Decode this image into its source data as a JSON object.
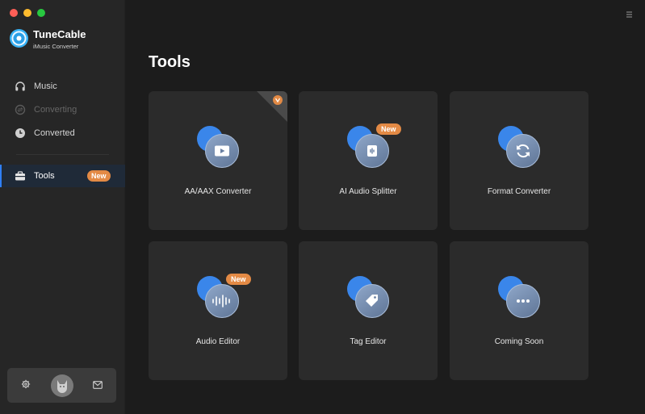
{
  "app": {
    "name": "TuneCable",
    "subtitle": "iMusic Converter"
  },
  "sidebar": {
    "items": [
      {
        "label": "Music",
        "icon": "headphones-icon",
        "state": "normal"
      },
      {
        "label": "Converting",
        "icon": "converting-icon",
        "state": "disabled"
      },
      {
        "label": "Converted",
        "icon": "clock-icon",
        "state": "normal"
      }
    ],
    "tools": {
      "label": "Tools",
      "icon": "toolbox-icon",
      "badge": "New",
      "state": "active"
    }
  },
  "page": {
    "title": "Tools"
  },
  "tools": [
    {
      "label": "AA/AAX Converter",
      "icon": "video-play-icon",
      "badge": "",
      "corner_badge": true
    },
    {
      "label": "AI Audio Splitter",
      "icon": "audio-split-icon",
      "badge": "New"
    },
    {
      "label": "Format Converter",
      "icon": "refresh-icon",
      "badge": ""
    },
    {
      "label": "Audio Editor",
      "icon": "waveform-icon",
      "badge": "New"
    },
    {
      "label": "Tag Editor",
      "icon": "tag-icon",
      "badge": ""
    },
    {
      "label": "Coming Soon",
      "icon": "more-dots-icon",
      "badge": ""
    }
  ],
  "colors": {
    "accent": "#2f7ff5",
    "badge": "#e38a45",
    "card": "#2b2b2b",
    "background": "#1c1c1c"
  }
}
